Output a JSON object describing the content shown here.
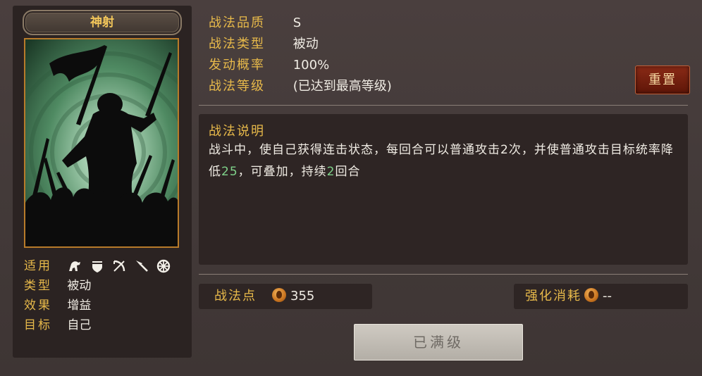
{
  "skill": {
    "name": "神射",
    "quality_label": "战法品质",
    "quality_value": "S",
    "type_label": "战法类型",
    "type_value": "被动",
    "rate_label": "发动概率",
    "rate_value": "100%",
    "level_label": "战法等级",
    "level_value": "(已达到最高等级)"
  },
  "left": {
    "props": [
      {
        "key": "适用",
        "value": ""
      },
      {
        "key": "类型",
        "value": "被动"
      },
      {
        "key": "效果",
        "value": "增益"
      },
      {
        "key": "目标",
        "value": "自己"
      }
    ],
    "troop_icons": [
      "cavalry-icon",
      "shield-icon",
      "bow-icon",
      "spear-icon",
      "wheel-icon"
    ]
  },
  "buttons": {
    "reset": "重置",
    "max_level": "已满级"
  },
  "description": {
    "title": "战法说明",
    "parts": [
      {
        "text": "战斗中，使自己获得连击状态，每回合可以普通攻击2次，并使普通攻击目标统率降低"
      },
      {
        "text": "25",
        "highlight": true
      },
      {
        "text": "，可叠加，持续"
      },
      {
        "text": "2",
        "highlight": true
      },
      {
        "text": "回合"
      }
    ]
  },
  "stats": {
    "points_label": "战法点",
    "points_value": "355",
    "cost_label": "强化消耗",
    "cost_value": "--"
  },
  "colors": {
    "gold": "#e7b94a",
    "highlight_green": "#7fd28a",
    "reset_red": "#6e1c0c"
  }
}
